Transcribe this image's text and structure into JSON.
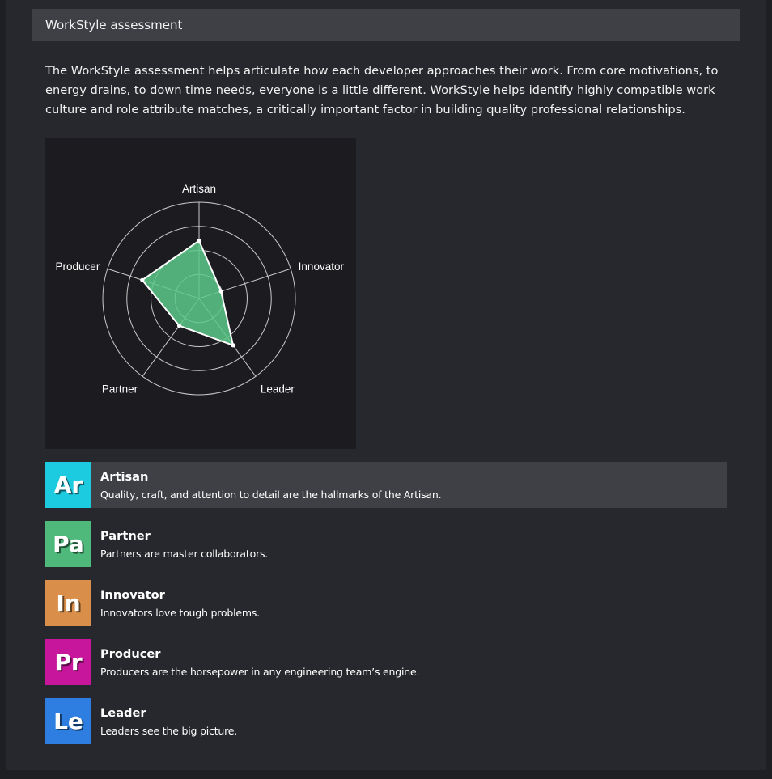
{
  "header": {
    "title": "WorkStyle assessment"
  },
  "intro": {
    "text": "The WorkStyle assessment helps articulate how each developer approaches their work. From core motivations, to energy drains, to down time needs, everyone is a little different. WorkStyle helps identify highly compatible work culture and role attribute matches, a critically important factor in building quality professional relationships."
  },
  "chart_data": {
    "type": "radar",
    "axes": [
      "Artisan",
      "Innovator",
      "Leader",
      "Partner",
      "Producer"
    ],
    "values": [
      0.6,
      0.24,
      0.6,
      0.35,
      0.62
    ],
    "max": 1,
    "rings": 4,
    "fill_color": "#5cc98a",
    "stroke_color": "#ffffff",
    "grid_color": "#c9c9c9"
  },
  "types": [
    {
      "abbr": "Ar",
      "name": "Artisan",
      "description": "Quality, craft, and attention to detail are the hallmarks of the Artisan.",
      "color": "#1dcbe0",
      "selected": true
    },
    {
      "abbr": "Pa",
      "name": "Partner",
      "description": "Partners are master collaborators.",
      "color": "#4fb87b",
      "selected": false
    },
    {
      "abbr": "In",
      "name": "Innovator",
      "description": "Innovators love tough problems.",
      "color": "#d98e49",
      "selected": false
    },
    {
      "abbr": "Pr",
      "name": "Producer",
      "description": "Producers are the horsepower in any engineering team’s engine.",
      "color": "#c8169c",
      "selected": false
    },
    {
      "abbr": "Le",
      "name": "Leader",
      "description": "Leaders see the big picture.",
      "color": "#2e7de0",
      "selected": false
    }
  ]
}
